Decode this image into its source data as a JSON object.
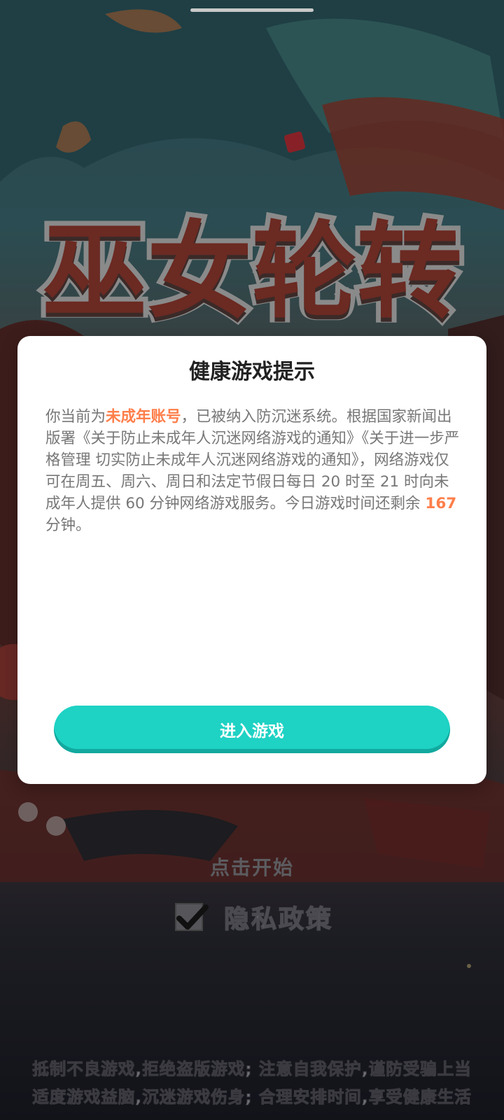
{
  "game": {
    "logo_text": "巫女轮转"
  },
  "dialog": {
    "title": "健康游戏提示",
    "body_part1": "你当前为",
    "body_highlight_account": "未成年账号",
    "body_part2": "，已被纳入防沉迷系统。根据国家新闻出版署《关于防止未成年人沉迷网络游戏的通知》《关于进一步严格管理 切实防止未成年人沉迷网络游戏的通知》，网络游戏仅可在周五、周六、周日和法定节假日每日 20 时至 21 时向未成年人提供 60 分钟网络游戏服务。今日游戏时间还剩余 ",
    "remaining_minutes": "167",
    "body_part3": " 分钟。",
    "enter_button_label": "进入游戏"
  },
  "start_screen": {
    "tap_to_start": "点击开始",
    "privacy_label": "隐私政策",
    "privacy_checked": true
  },
  "health_notice": {
    "line1": "抵制不良游戏,拒绝盗版游戏; 注意自我保护,谨防受骗上当",
    "line2": "适度游戏益脑,沉迷游戏伤身; 合理安排时间,享受健康生活"
  },
  "colors": {
    "accent_orange": "#ff7e4a",
    "button_teal": "#1ed2c4"
  }
}
